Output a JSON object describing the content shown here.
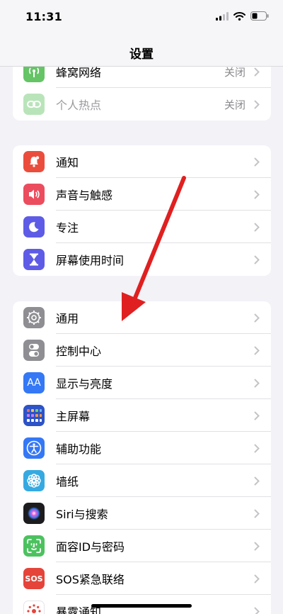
{
  "status_bar": {
    "time": "11:31"
  },
  "nav": {
    "title": "设置"
  },
  "group1": [
    {
      "label": "蜂窝网络",
      "value": "关闭",
      "icon": "antenna-icon",
      "color": "#65c466"
    },
    {
      "label": "个人热点",
      "value": "关闭",
      "icon": "link-icon",
      "color": "#65c466"
    }
  ],
  "group2": [
    {
      "label": "通知",
      "icon": "bell-icon",
      "color": "#eb4d3d"
    },
    {
      "label": "声音与触感",
      "icon": "speaker-icon",
      "color": "#eb4d5e"
    },
    {
      "label": "专注",
      "icon": "moon-icon",
      "color": "#5e5ce6"
    },
    {
      "label": "屏幕使用时间",
      "icon": "hourglass-icon",
      "color": "#5e5ce6"
    }
  ],
  "group3": [
    {
      "label": "通用",
      "icon": "gear-icon",
      "color": "#8e8e93"
    },
    {
      "label": "控制中心",
      "icon": "toggles-icon",
      "color": "#8e8e93"
    },
    {
      "label": "显示与亮度",
      "icon": "aa-icon",
      "glyph": "AA",
      "color": "#3478f6"
    },
    {
      "label": "主屏幕",
      "icon": "home-grid-icon",
      "color": "#2c53c7"
    },
    {
      "label": "辅助功能",
      "icon": "accessibility-icon",
      "color": "#3478f6"
    },
    {
      "label": "墙纸",
      "icon": "flower-icon",
      "color": "#36a9e1"
    },
    {
      "label": "Siri与搜索",
      "icon": "siri-icon",
      "color": "#1c1c1e"
    },
    {
      "label": "面容ID与密码",
      "icon": "faceid-icon",
      "color": "#4cc25f"
    },
    {
      "label": "SOS紧急联络",
      "icon": "sos-icon",
      "glyph": "SOS",
      "color": "#e5443a"
    },
    {
      "label": "暴露通知",
      "icon": "exposure-icon",
      "color": "#ffffff"
    }
  ],
  "colors": {
    "annotation_arrow": "#e02020",
    "background": "#f2f2f7"
  }
}
